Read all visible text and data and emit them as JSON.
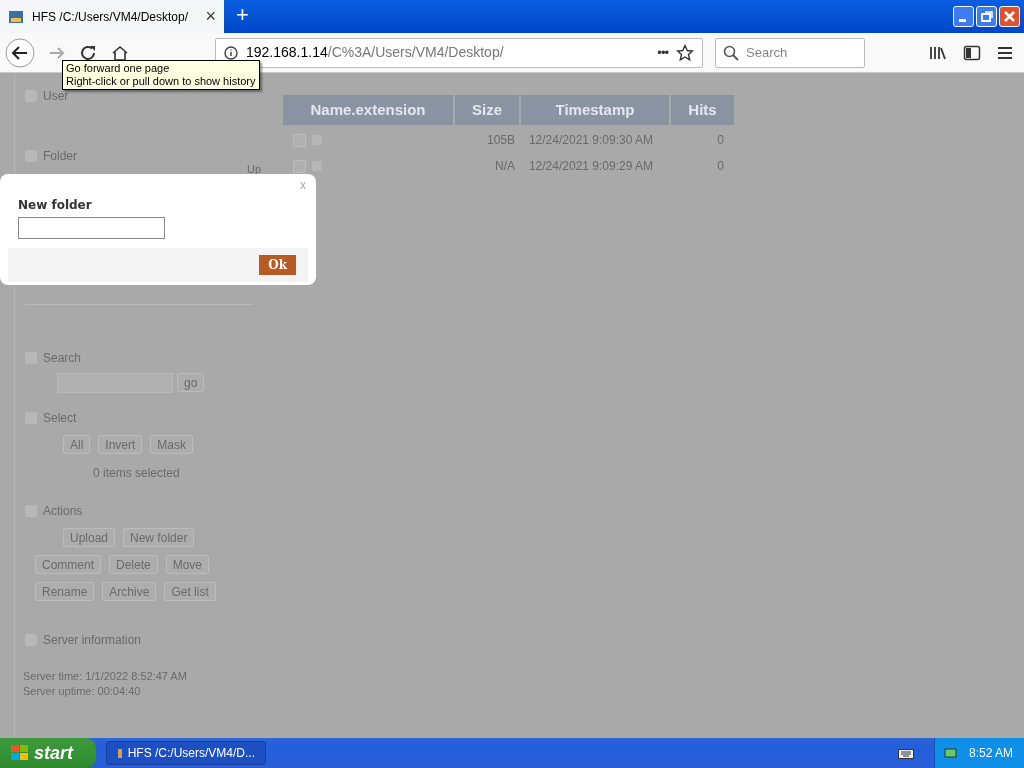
{
  "browser": {
    "tab_title": "HFS /C:/Users/VM4/Desktop/",
    "tab_close": "×",
    "new_tab": "+",
    "url_host": "192.168.1.14",
    "url_path": "/C%3A/Users/VM4/Desktop/",
    "url_more": "•••",
    "search_placeholder": "Search",
    "tooltip": [
      "Go forward one page",
      "Right-click or pull down to show history"
    ]
  },
  "sidebar": {
    "user_title": "User",
    "folder_title": "Folder",
    "up_link": "Up",
    "search_title": "Search",
    "go_button": "go",
    "select_title": "Select",
    "select_buttons": [
      "All",
      "Invert",
      "Mask"
    ],
    "selected_count": "0 items selected",
    "actions_title": "Actions",
    "action_rows": [
      [
        "Upload",
        "New folder"
      ],
      [
        "Comment",
        "Delete",
        "Move"
      ],
      [
        "Rename",
        "Archive",
        "Get list"
      ]
    ],
    "server_title": "Server information",
    "server_lines": [
      "Server time: 1/1/2022 8:52:47 AM",
      "Server uptime: 00:04:40"
    ]
  },
  "table": {
    "columns": [
      "Name.extension",
      "Size",
      "Timestamp",
      "Hits"
    ],
    "rows": [
      {
        "checked": false,
        "size": "105B",
        "timestamp": "12/24/2021 9:09:30 AM",
        "hits": "0"
      },
      {
        "checked": false,
        "size": "N/A",
        "timestamp": "12/24/2021 9:09:29 AM",
        "hits": "0"
      }
    ]
  },
  "dialog": {
    "close": "x",
    "label": "New folder",
    "ok": "Ok"
  },
  "taskbar": {
    "start": "start",
    "task": "HFS /C:/Users/VM4/D...",
    "clock": "8:52 AM"
  }
}
